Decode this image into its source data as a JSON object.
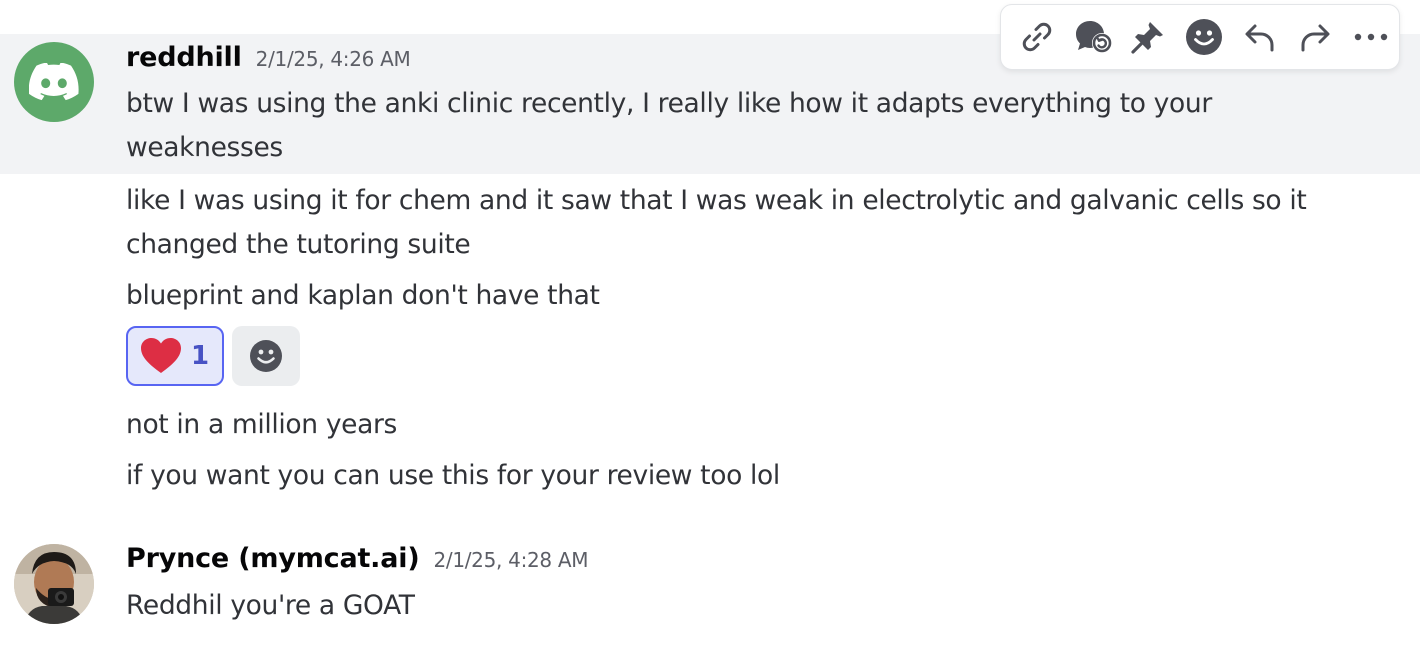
{
  "toolbar": {
    "icons": [
      "link-icon",
      "thread-icon",
      "pin-icon",
      "emoji-icon",
      "reply-icon",
      "forward-icon",
      "more-icon"
    ]
  },
  "messages": [
    {
      "author": "reddhill",
      "timestamp": "2/1/25, 4:26 AM",
      "avatar": "discord-logo-icon",
      "lines": [
        "btw I was using the anki clinic recently, I really like how it adapts everything to your weaknesses",
        "like I was using it for chem and it saw that I was weak in electrolytic and galvanic cells so it changed the tutoring suite",
        "blueprint and kaplan don't have that"
      ],
      "reactions": [
        {
          "emoji": "heart-icon",
          "count": "1",
          "active": true
        }
      ],
      "followups": [
        "not in a million years",
        "if you want you can use this for your review too lol"
      ]
    },
    {
      "author": "Prynce (mymcat.ai)",
      "timestamp": "2/1/25, 4:28 AM",
      "avatar": "user-photo",
      "lines": [
        "Reddhil you're a GOAT"
      ]
    }
  ],
  "colors": {
    "discord_avatar": "#5da96a",
    "reaction_active_bg": "#e5e8fb",
    "reaction_active_border": "#5865f2",
    "heart": "#dd2e44",
    "hover_bg": "#f2f3f5"
  }
}
